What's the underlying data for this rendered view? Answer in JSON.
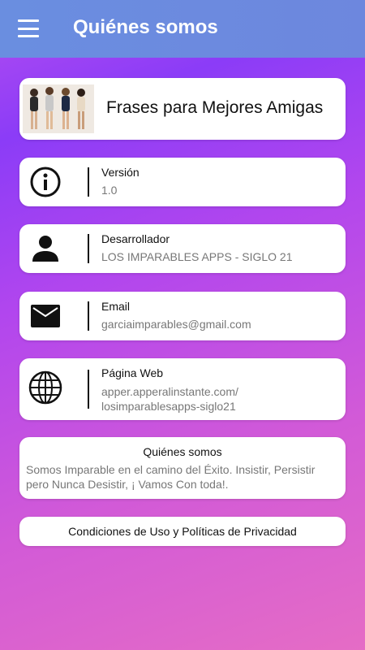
{
  "appbar": {
    "menu_icon": "menu-icon",
    "title": "Quiénes somos"
  },
  "app": {
    "name": "Frases para Mejores Amigas",
    "thumbnail": "photo-of-four-girls"
  },
  "info": {
    "version": {
      "icon": "info-icon",
      "label": "Versión",
      "value": "1.0"
    },
    "developer": {
      "icon": "person-icon",
      "label": "Desarrollador",
      "value": "LOS IMPARABLES APPS - SIGLO 21"
    },
    "email": {
      "icon": "mail-icon",
      "label": "Email",
      "value": "garciaimparables@gmail.com"
    },
    "web": {
      "icon": "globe-icon",
      "label": "Página Web",
      "value_line1": "apper.apperalinstante.com/",
      "value_line2": "losimparablesapps-siglo21"
    }
  },
  "about": {
    "title": "Quiénes somos",
    "text_line1": "Somos Imparable en el camino del Éxito. Insistir, Persistir",
    "text_line2": "pero Nunca Desistir, ¡ Vamos Con toda!."
  },
  "terms": {
    "label": "Condiciones de Uso y Políticas de Privacidad"
  },
  "colors": {
    "appbar": "#6a8ee0",
    "gradient_top": "#8b3cf7",
    "gradient_bottom": "#e56cc5"
  }
}
